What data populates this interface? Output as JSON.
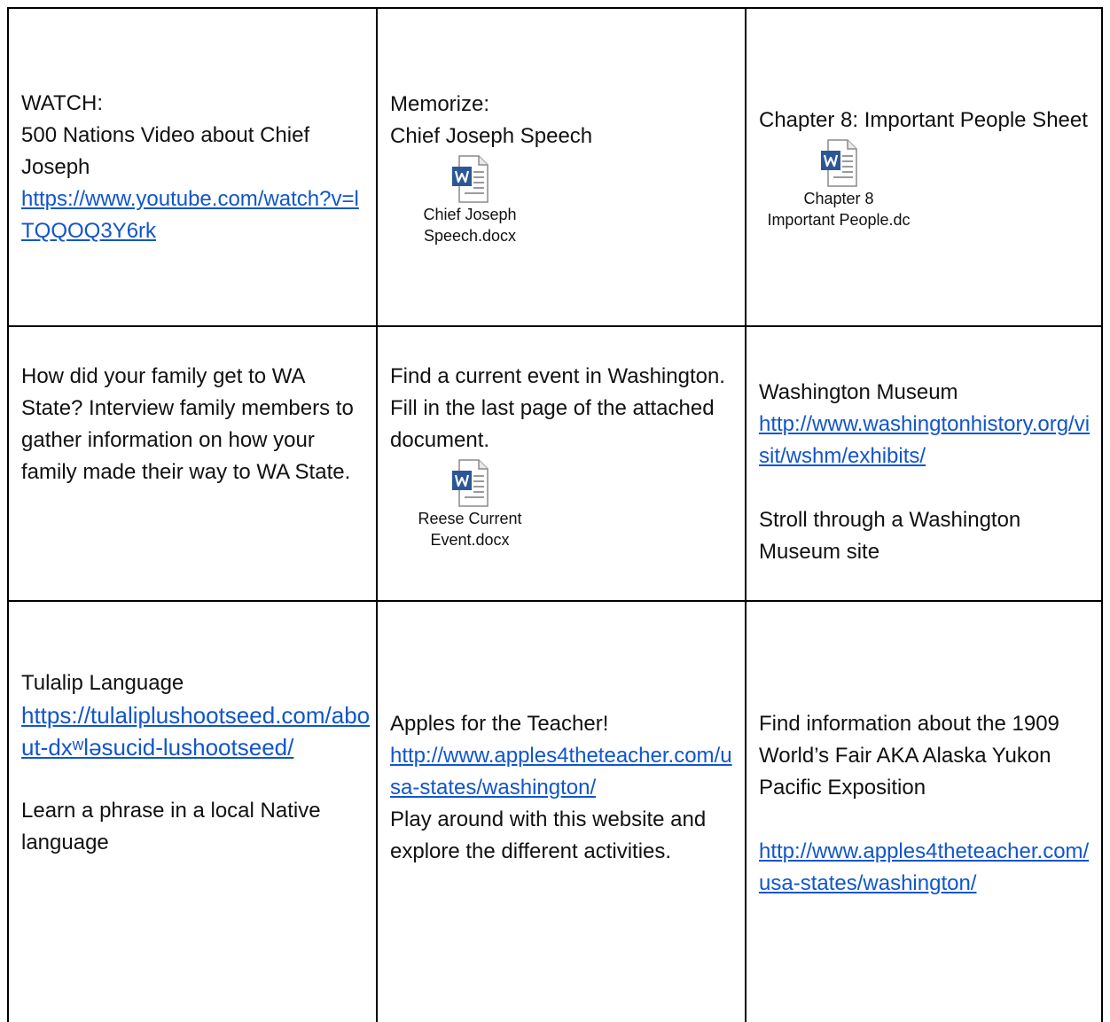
{
  "rows": [
    [
      {
        "pre": "WATCH:\n500 Nations Video about Chief Joseph",
        "link": "https://www.youtube.com/watch?v=lTQQOQ3Y6rk"
      },
      {
        "pre": "Memorize:\nChief Joseph Speech",
        "attachment": {
          "icon": "word-document-icon",
          "caption": "Chief Joseph\nSpeech.docx"
        }
      },
      {
        "pre": "Chapter 8:  Important People Sheet",
        "attachment": {
          "icon": "word-document-icon",
          "caption": "Chapter 8\nImportant People.dc"
        }
      }
    ],
    [
      {
        "pre": "How did your family get to WA State? Interview family members to gather information on how your family made their way to WA State."
      },
      {
        "pre": "Find a current event in Washington.\nFill in the last page of the attached document.",
        "attachment": {
          "icon": "word-document-icon",
          "caption": "Reese Current\nEvent.docx"
        }
      },
      {
        "pre": "Washington Museum",
        "link": "http://www.washingtonhistory.org/visit/wshm/exhibits/",
        "post": "Stroll through a Washington Museum site"
      }
    ],
    [
      {
        "pre": "Tulalip Language",
        "link": "https://tulaliplushootseed.com/about-dxʷləsucid-lushootseed/",
        "post": "Learn a phrase in a local Native language"
      },
      {
        "pre": "Apples for the Teacher!",
        "link": "http://www.apples4theteacher.com/usa-states/washington/",
        "post_inline": "Play around with this website and explore the different activities."
      },
      {
        "pre": "Find information about the 1909 World’s Fair AKA Alaska Yukon Pacific Exposition",
        "link": "http://www.apples4theteacher.com/usa-states/washington/"
      }
    ]
  ],
  "colors": {
    "link": "#1155CC",
    "text": "#111111",
    "border": "#000000",
    "word_blue": "#2B5797"
  }
}
